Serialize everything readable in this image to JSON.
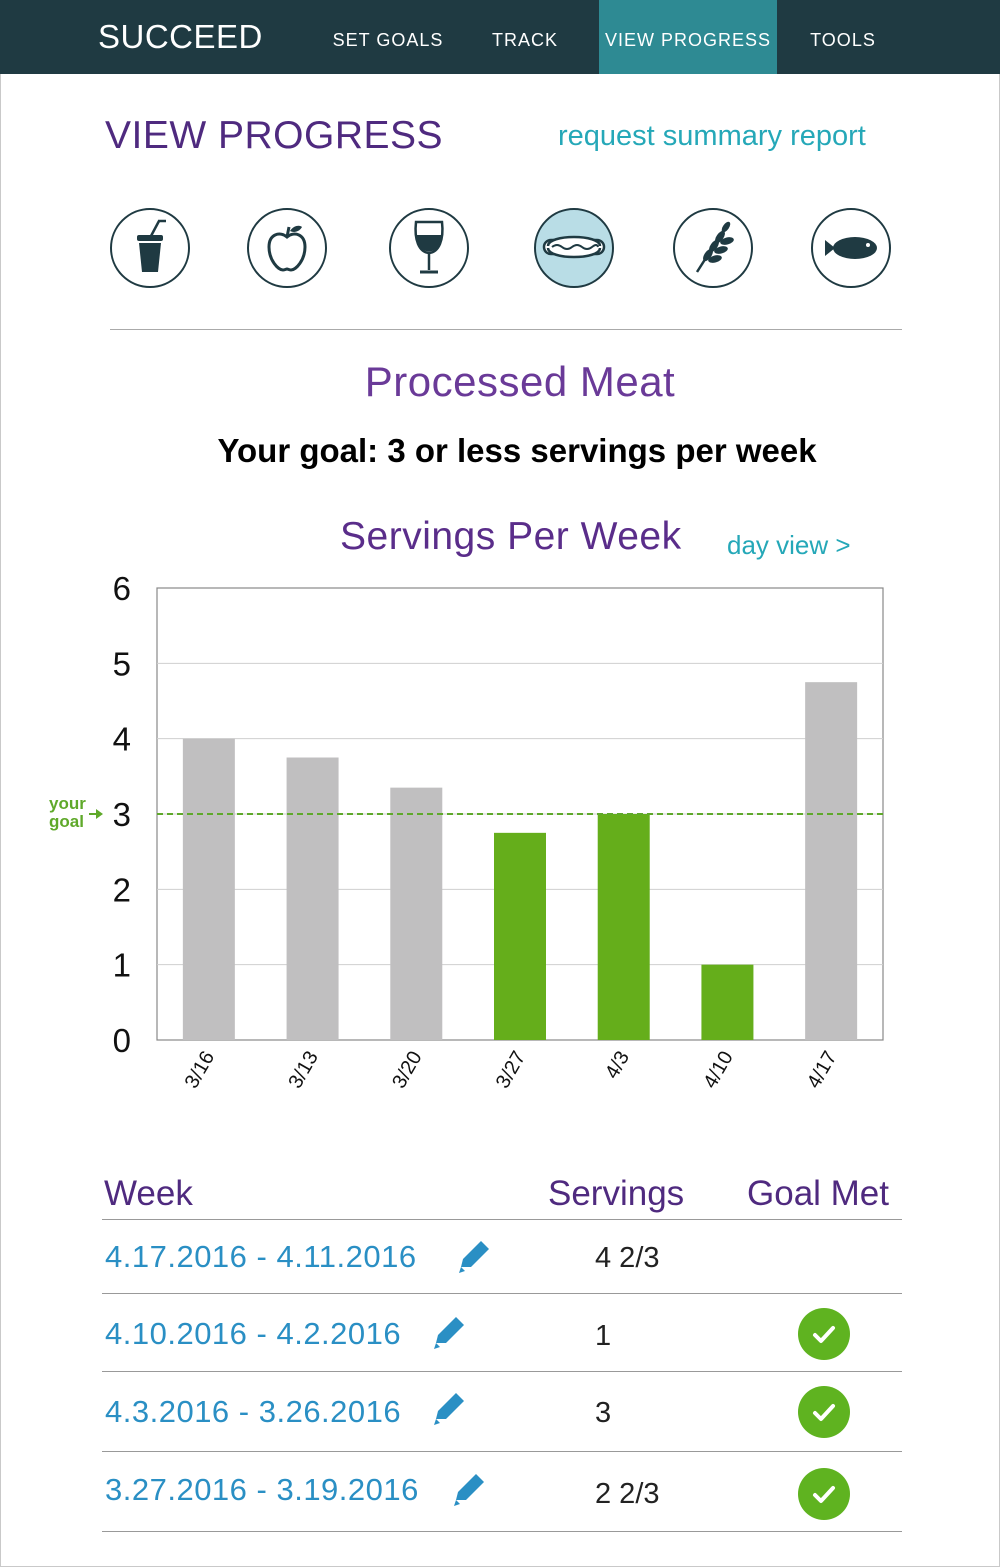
{
  "nav": {
    "brand": "SUCCEED",
    "items": [
      {
        "label": "SET GOALS"
      },
      {
        "label": "TRACK"
      },
      {
        "label": "VIEW PROGRESS",
        "active": true
      },
      {
        "label": "TOOLS"
      }
    ]
  },
  "header": {
    "title": "VIEW PROGRESS",
    "summary_link": "request summary report"
  },
  "categories": [
    {
      "icon": "soda-cup-icon"
    },
    {
      "icon": "apple-icon"
    },
    {
      "icon": "wine-glass-icon"
    },
    {
      "icon": "hot-dog-icon",
      "active": true
    },
    {
      "icon": "wheat-icon"
    },
    {
      "icon": "fish-icon"
    }
  ],
  "category_title": "Processed Meat",
  "goal_text": "Your goal: 3 or less servings per week",
  "chart_header": {
    "title": "Servings Per Week",
    "day_view": "day view >"
  },
  "chart_data": {
    "type": "bar",
    "categories": [
      "3/16",
      "3/13",
      "3/20",
      "3/27",
      "4/3",
      "4/10",
      "4/17"
    ],
    "values": [
      4,
      3.75,
      3.35,
      2.75,
      3,
      1,
      4.75
    ],
    "goal_met": [
      false,
      false,
      false,
      true,
      true,
      true,
      false
    ],
    "goal": 3,
    "goal_label": [
      "your",
      "goal"
    ],
    "ylim": [
      0,
      6
    ],
    "yticks": [
      0,
      1,
      2,
      3,
      4,
      5,
      6
    ],
    "grid": true,
    "colors": {
      "met": "#65ae1b",
      "not_met": "#c0bfc0",
      "goal_line": "#5fa92a"
    }
  },
  "table": {
    "headers": {
      "week": "Week",
      "servings": "Servings",
      "goal_met": "Goal Met"
    },
    "rows": [
      {
        "week": "4.17.2016 - 4.11.2016",
        "servings": "4 2/3",
        "goal_met": false
      },
      {
        "week": "4.10.2016 - 4.2.2016",
        "servings": "1",
        "goal_met": true
      },
      {
        "week": "4.3.2016 - 3.26.2016",
        "servings": "3",
        "goal_met": true
      },
      {
        "week": "3.27.2016 - 3.19.2016",
        "servings": "2 2/3",
        "goal_met": true
      }
    ]
  }
}
